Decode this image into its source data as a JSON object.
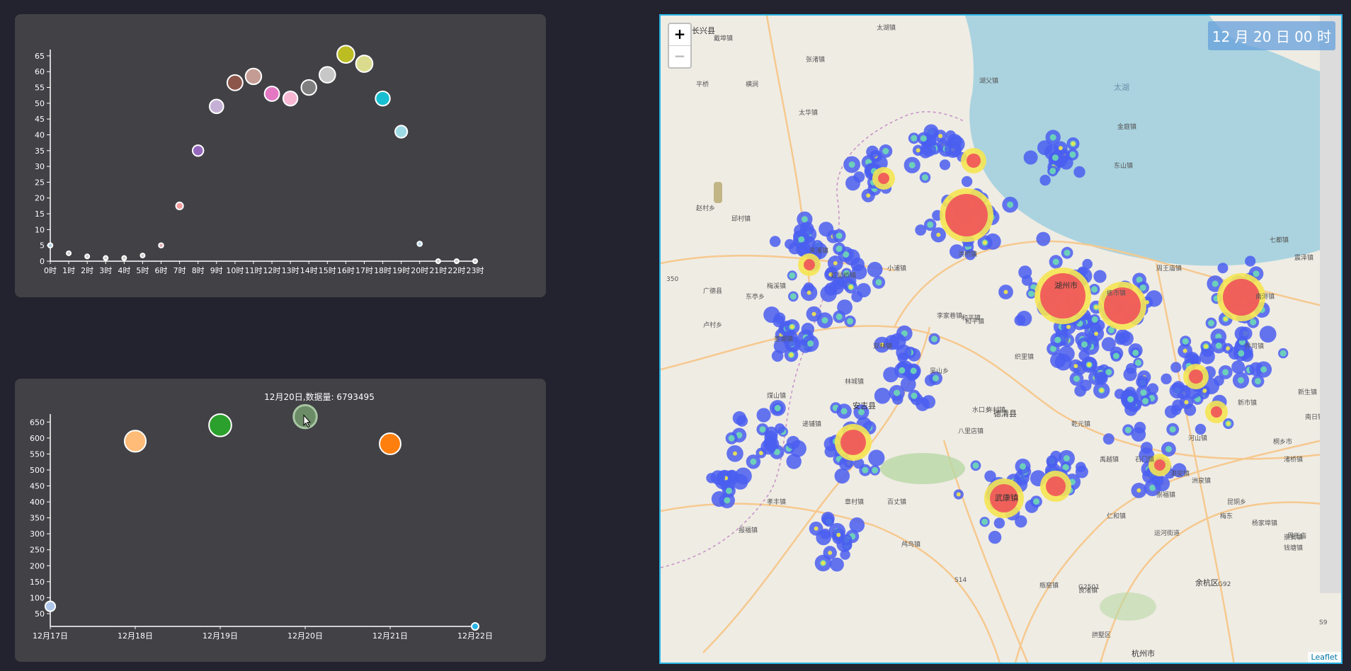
{
  "chart_data": [
    {
      "type": "scatter",
      "title": "",
      "xlabel": "",
      "ylabel": "",
      "categories": [
        "0时",
        "1时",
        "2时",
        "3时",
        "4时",
        "5时",
        "6时",
        "7时",
        "8时",
        "9时",
        "10时",
        "11时",
        "12时",
        "13时",
        "14时",
        "15时",
        "16时",
        "17时",
        "18时",
        "19时",
        "20时",
        "21时",
        "22时",
        "23时"
      ],
      "values": [
        5,
        2.5,
        1.5,
        1,
        1,
        1.8,
        5,
        17.5,
        35,
        49,
        56.5,
        58.5,
        53,
        51.5,
        55,
        59,
        65.5,
        62.5,
        51.5,
        41,
        5.5,
        0,
        0,
        0
      ],
      "colors": [
        "#a6cee3",
        "#cccccc",
        "#cccccc",
        "#cccccc",
        "#cccccc",
        "#cccccc",
        "#e7a7b0",
        "#f49c9c",
        "#9467bd",
        "#c5b0d5",
        "#8c564b",
        "#c49c94",
        "#e377c2",
        "#f7b6d2",
        "#7f7f7f",
        "#c7c7c7",
        "#bcbd22",
        "#dbdb8d",
        "#17becf",
        "#9edae5",
        "#b0d9ee",
        "#cccccc",
        "#cccccc",
        "#cccccc"
      ],
      "yticks": [
        0,
        5,
        10,
        15,
        20,
        25,
        30,
        35,
        40,
        45,
        50,
        55,
        60,
        65
      ],
      "ylim": [
        0,
        67
      ]
    },
    {
      "type": "scatter",
      "title": "",
      "xlabel": "",
      "ylabel": "",
      "categories": [
        "12月17日",
        "12月18日",
        "12月19日",
        "12月20日",
        "12月21日",
        "12月22日"
      ],
      "values": [
        73,
        590,
        640,
        667,
        582,
        0
      ],
      "colors": [
        "#aec7e8",
        "#ffbb78",
        "#2ca02c",
        "#6b8c67",
        "#ff7f0e",
        "#2bb5e6"
      ],
      "yticks": [
        50,
        100,
        150,
        200,
        250,
        300,
        350,
        400,
        450,
        500,
        550,
        600,
        650
      ],
      "ylim": [
        10,
        675
      ],
      "tooltip": "12月20日,数据量: 6793495"
    }
  ],
  "map": {
    "time_label": "12 月 20 日 00 时",
    "zoom_in": "+",
    "zoom_out": "−",
    "attribution": "Leaflet",
    "lake_label": "太湖",
    "place_labels": [
      "湖州市",
      "长兴县",
      "安吉县",
      "德清县",
      "武康镇",
      "余杭区",
      "杭州市",
      "桐乡市",
      "广德县",
      "拱墅区",
      "南浔镇",
      "练市镇",
      "新市镇",
      "和平镇",
      "东亭乡",
      "卢村乡",
      "梅溪镇",
      "递铺镇",
      "孝丰镇",
      "报福镇",
      "章村镇",
      "百丈镇",
      "鸬鸟镇",
      "瓶窑镇",
      "良渚镇",
      "运河街道",
      "崇福镇",
      "石门镇",
      "洲泉镇",
      "河山镇",
      "禹越镇",
      "乾元镇",
      "织里镇",
      "八里店镇",
      "双林镇",
      "菱湖镇",
      "洪桥镇",
      "水口乡",
      "夹浦镇",
      "煤山镇",
      "泗安镇",
      "林城镇",
      "李家巷镇",
      "吴山乡",
      "虹星桥镇",
      "小浦镇",
      "和平镇",
      "金庭镇",
      "东山镇",
      "七都镇",
      "震泽镇",
      "平桥",
      "赵村乡",
      "邱村镇",
      "太华镇",
      "横涧",
      "张渚镇",
      "湖父镇",
      "戴埠镇",
      "太湖镇",
      "西亭乡",
      "渚桥镇",
      "昆铜乡",
      "杨家埠镇",
      "梅东",
      "仁和镇",
      "周王庙镇",
      "许村镇",
      "新生镇",
      "南日镇",
      "崇贤镇",
      "钱塘镇",
      "周王庙",
      "乔司镇",
      "G2501",
      "G92",
      "S14",
      "S9",
      "350"
    ]
  }
}
